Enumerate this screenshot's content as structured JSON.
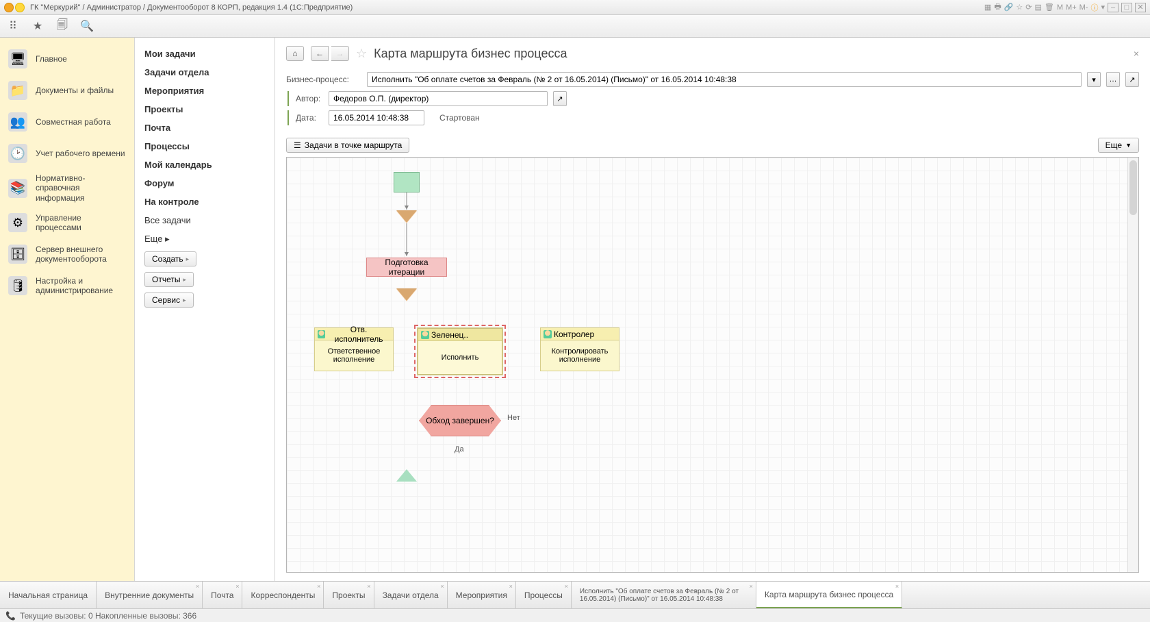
{
  "titlebar": {
    "text": "ГК \"Меркурий\" / Администратор / Документооборот 8 КОРП, редакция 1.4  (1С:Предприятие)",
    "win_min": "–",
    "win_max": "□",
    "win_close": "✕",
    "m_lbls": [
      "M",
      "M+",
      "M-"
    ]
  },
  "left_nav": [
    {
      "label": "Главное"
    },
    {
      "label": "Документы и файлы"
    },
    {
      "label": "Совместная работа"
    },
    {
      "label": "Учет рабочего времени"
    },
    {
      "label": "Нормативно-справочная информация"
    },
    {
      "label": "Управление процессами"
    },
    {
      "label": "Сервер внешнего документооборота"
    },
    {
      "label": "Настройка и администрирование"
    }
  ],
  "sub_nav": {
    "items": [
      {
        "label": "Мои задачи",
        "bold": true
      },
      {
        "label": "Задачи отдела",
        "bold": true
      },
      {
        "label": "Мероприятия",
        "bold": true
      },
      {
        "label": "Проекты",
        "bold": true
      },
      {
        "label": "Почта",
        "bold": true
      },
      {
        "label": "Процессы",
        "bold": true
      },
      {
        "label": "Мой календарь",
        "bold": true
      },
      {
        "label": "Форум",
        "bold": true
      },
      {
        "label": "На контроле",
        "bold": true
      },
      {
        "label": "Все задачи",
        "bold": false
      },
      {
        "label": "Еще ▸",
        "bold": false
      }
    ],
    "buttons": [
      "Создать",
      "Отчеты",
      "Сервис"
    ]
  },
  "page": {
    "title": "Карта маршрута бизнес процесса",
    "bp_label": "Бизнес-процесс:",
    "bp_value": "Исполнить \"Об оплате счетов за Февраль (№ 2 от 16.05.2014) (Письмо)\" от 16.05.2014 10:48:38",
    "author_label": "Автор:",
    "author_value": "Федоров О.П. (директор)",
    "date_label": "Дата:",
    "date_value": "16.05.2014 10:48:38",
    "status": "Стартован",
    "tb_tasks": "Задачи в точке маршрута",
    "tb_more": "Еще"
  },
  "diagram": {
    "prep": "Подготовка итерации",
    "t1_head": "Отв. исполнитель",
    "t1_body": "Ответственное исполнение",
    "t2_head": "Зеленец..",
    "t2_body": "Исполнить",
    "t3_head": "Контролер",
    "t3_body": "Контролировать исполнение",
    "decision": "Обход завершен?",
    "no": "Нет",
    "yes": "Да"
  },
  "bottom_tabs": [
    {
      "label": "Начальная страница",
      "closable": false
    },
    {
      "label": "Внутренние документы",
      "closable": true
    },
    {
      "label": "Почта",
      "closable": true
    },
    {
      "label": "Корреспонденты",
      "closable": true
    },
    {
      "label": "Проекты",
      "closable": true
    },
    {
      "label": "Задачи отдела",
      "closable": true
    },
    {
      "label": "Мероприятия",
      "closable": true
    },
    {
      "label": "Процессы",
      "closable": true
    },
    {
      "label": "Исполнить \"Об оплате счетов за Февраль (№ 2 от 16.05.2014) (Письмо)\" от 16.05.2014 10:48:38",
      "closable": true
    },
    {
      "label": "Карта маршрута бизнес процесса",
      "closable": true,
      "active": true
    }
  ],
  "status_bar": {
    "text": "Текущие вызовы: 0  Накопленные вызовы: 366"
  }
}
